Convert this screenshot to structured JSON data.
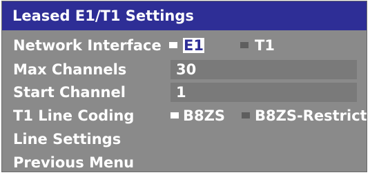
{
  "title": "Leased E1/T1 Settings",
  "rows": {
    "network_interface": {
      "label": "Network Interface",
      "options": [
        "E1",
        "T1"
      ],
      "selected": "E1"
    },
    "max_channels": {
      "label": "Max Channels",
      "value": "30"
    },
    "start_channel": {
      "label": "Start Channel",
      "value": "1"
    },
    "t1_line_coding": {
      "label": "T1 Line Coding",
      "options": [
        "B8ZS",
        "B8ZS-Restrict"
      ],
      "selected": "B8ZS"
    },
    "line_settings": {
      "label": "Line Settings"
    },
    "previous_menu": {
      "label": "Previous Menu"
    }
  },
  "colors": {
    "title_bar": "#2e2e96",
    "panel": "#8a8a8a",
    "field": "#7a7a7a",
    "text": "#ffffff"
  }
}
